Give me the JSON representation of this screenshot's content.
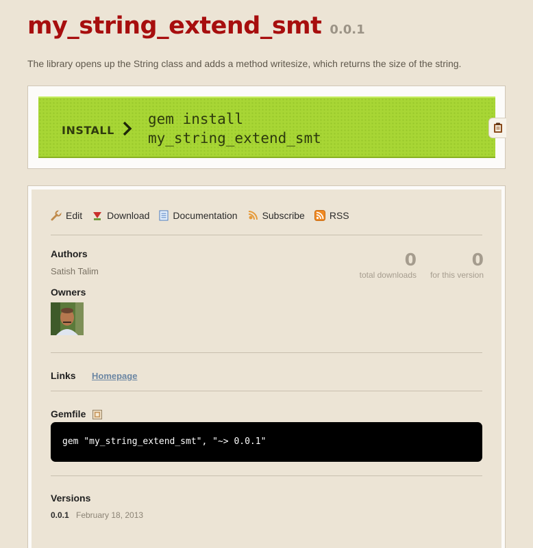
{
  "gem": {
    "name": "my_string_extend_smt",
    "version": "0.0.1",
    "description": "The library opens up the String class and adds a method writesize, which returns the size of the string."
  },
  "install": {
    "label": "INSTALL",
    "command_line1": "gem install",
    "command_line2": "my_string_extend_smt"
  },
  "actions": [
    {
      "label": "Edit",
      "icon": "wrench-icon"
    },
    {
      "label": "Download",
      "icon": "download-icon"
    },
    {
      "label": "Documentation",
      "icon": "document-icon"
    },
    {
      "label": "Subscribe",
      "icon": "subscribe-icon"
    },
    {
      "label": "RSS",
      "icon": "rss-icon"
    }
  ],
  "authors": {
    "heading": "Authors",
    "names": "Satish Talim"
  },
  "stats": {
    "total_downloads": "0",
    "total_downloads_label": "total downloads",
    "this_version": "0",
    "this_version_label": "for this version"
  },
  "owners": {
    "heading": "Owners"
  },
  "links": {
    "heading": "Links",
    "homepage": "Homepage"
  },
  "gemfile": {
    "heading": "Gemfile",
    "code": "gem \"my_string_extend_smt\", \"~> 0.0.1\""
  },
  "versions": {
    "heading": "Versions",
    "items": [
      {
        "number": "0.0.1",
        "date": "February 18, 2013"
      }
    ]
  },
  "colors": {
    "background": "#ece4d5",
    "title": "#a70e0e",
    "install_green": "#a8d635",
    "link": "#6b86a3"
  }
}
